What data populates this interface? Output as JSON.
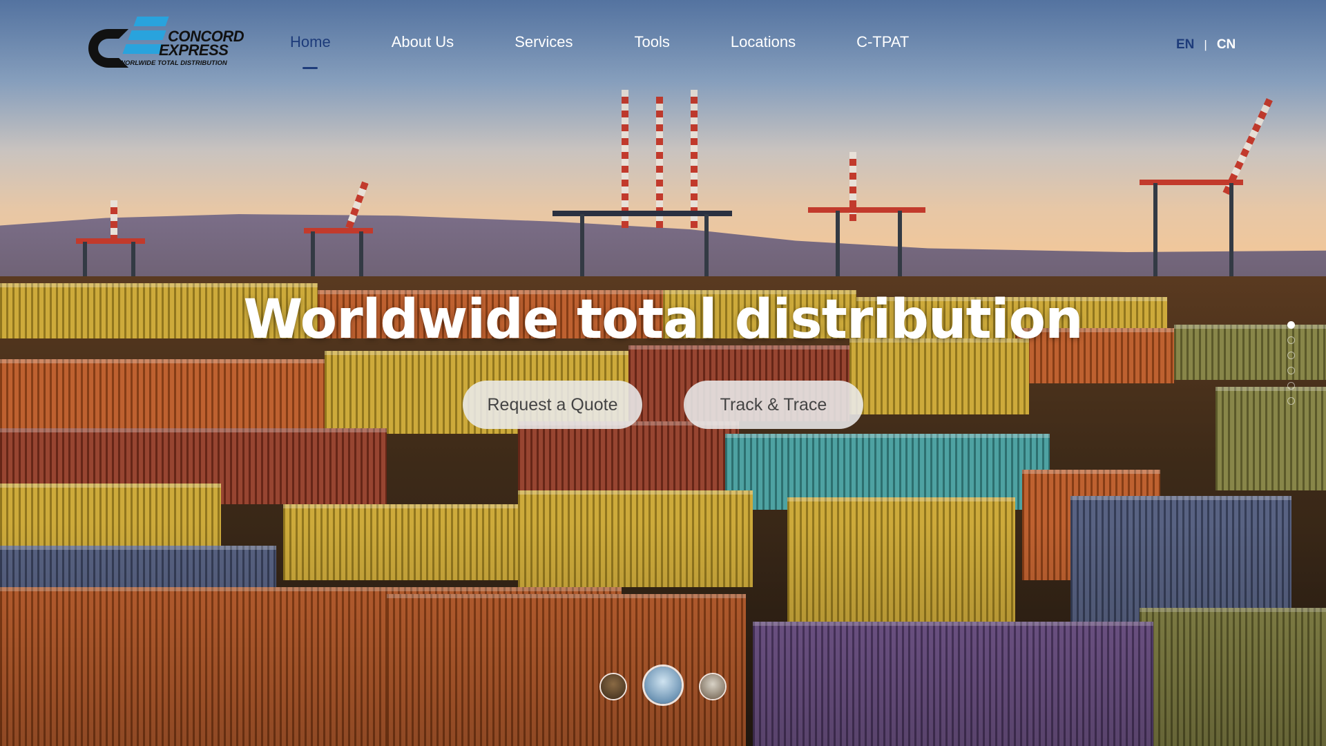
{
  "brand": {
    "name_line1": "CONCORD",
    "name_line2": "EXPRESS",
    "tagline": "WORLWIDE TOTAL DISTRIBUTION",
    "colors": {
      "logo_blue": "#29a3dd",
      "logo_black": "#111111"
    }
  },
  "nav": {
    "items": [
      {
        "label": "Home",
        "active": true
      },
      {
        "label": "About Us",
        "active": false
      },
      {
        "label": "Services",
        "active": false
      },
      {
        "label": "Tools",
        "active": false
      },
      {
        "label": "Locations",
        "active": false
      },
      {
        "label": "C-TPAT",
        "active": false
      }
    ],
    "active_color": "#1d3b7a"
  },
  "language": {
    "en": "EN",
    "separator": "|",
    "cn": "CN",
    "selected": "EN"
  },
  "hero": {
    "headline": "Worldwide total distribution",
    "buttons": {
      "quote": "Request a Quote",
      "track": "Track & Trace"
    },
    "background": "container-port-photo"
  },
  "slider": {
    "dots_count": 6,
    "active_dot": 1,
    "thumbnails": [
      {
        "name": "containers-thumbnail",
        "selected": false
      },
      {
        "name": "airplane-thumbnail",
        "selected": true
      },
      {
        "name": "truck-thumbnail",
        "selected": false
      }
    ]
  }
}
